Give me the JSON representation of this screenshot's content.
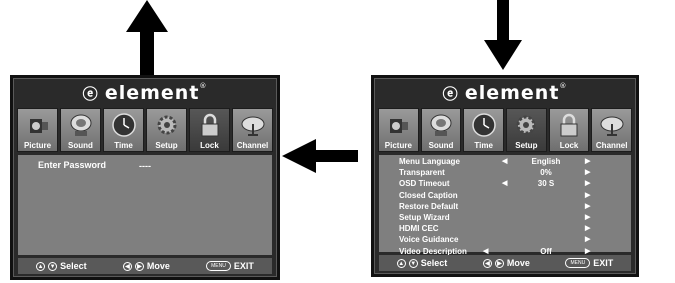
{
  "left_screen": {
    "brand": "element",
    "tabs": [
      {
        "label": "Picture",
        "icon": "camcorder-icon"
      },
      {
        "label": "Sound",
        "icon": "speaker-icon"
      },
      {
        "label": "Time",
        "icon": "clock-icon"
      },
      {
        "label": "Setup",
        "icon": "gear-icon"
      },
      {
        "label": "Lock",
        "icon": "padlock-icon",
        "active": true
      },
      {
        "label": "Channel",
        "icon": "satellite-dish-icon"
      }
    ],
    "password_label": "Enter Password",
    "password_value": "----",
    "footer": {
      "select": "Select",
      "move": "Move",
      "menu_button": "MENU",
      "exit": "EXIT"
    }
  },
  "right_screen": {
    "brand": "element",
    "tabs": [
      {
        "label": "Picture",
        "icon": "camcorder-icon"
      },
      {
        "label": "Sound",
        "icon": "speaker-icon"
      },
      {
        "label": "Time",
        "icon": "clock-icon"
      },
      {
        "label": "Setup",
        "icon": "gear-icon",
        "active": true
      },
      {
        "label": "Lock",
        "icon": "padlock-icon"
      },
      {
        "label": "Channel",
        "icon": "satellite-dish-icon"
      }
    ],
    "menu_items": [
      {
        "label": "Menu Language",
        "value": "English",
        "left_arrow": true,
        "right_arrow": true
      },
      {
        "label": "Transparent",
        "value": "0%",
        "left_arrow": false,
        "right_arrow": true
      },
      {
        "label": "OSD Timeout",
        "value": "30 S",
        "left_arrow": true,
        "right_arrow": true
      },
      {
        "label": "Closed Caption",
        "value": "",
        "left_arrow": false,
        "right_arrow": true
      },
      {
        "label": "Restore Default",
        "value": "",
        "left_arrow": false,
        "right_arrow": true
      },
      {
        "label": "Setup Wizard",
        "value": "",
        "left_arrow": false,
        "right_arrow": true
      },
      {
        "label": "HDMI CEC",
        "value": "",
        "left_arrow": false,
        "right_arrow": true
      },
      {
        "label": "Voice Guidance",
        "value": "",
        "left_arrow": false,
        "right_arrow": true
      },
      {
        "label": "Video Description",
        "value": "Off",
        "left_arrow": true,
        "right_arrow": true
      }
    ],
    "footer": {
      "select": "Select",
      "move": "Move",
      "menu_button": "MENU",
      "exit": "EXIT"
    }
  },
  "arrows": {
    "top_left": "up-arrow-icon",
    "top_right": "down-arrow-icon",
    "middle": "left-arrow-icon"
  },
  "colors": {
    "panel_frame": "#2a2a2a",
    "content_bg": "#7f7f7f",
    "footer_bg": "#595959",
    "text": "#ffffff",
    "arrow": "#000000"
  }
}
